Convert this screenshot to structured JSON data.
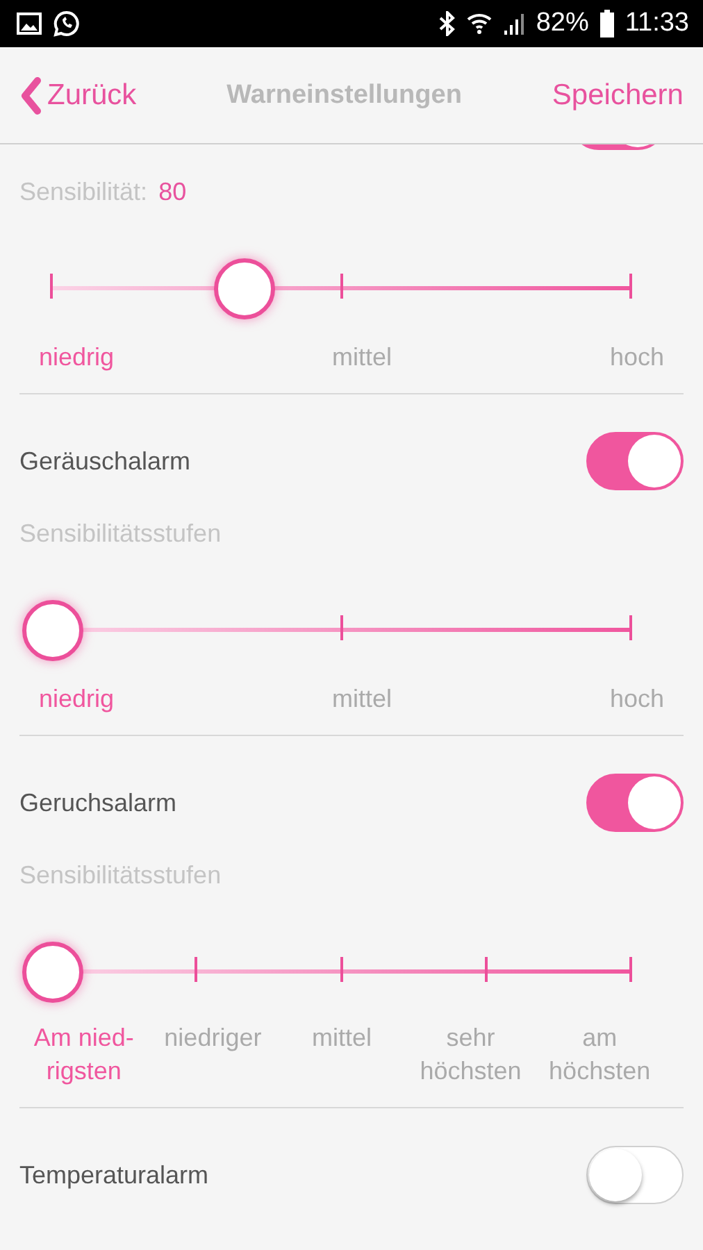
{
  "status_bar": {
    "battery": "82%",
    "time": "11:33"
  },
  "nav": {
    "back": "Zurück",
    "title": "Warneinstellungen",
    "save": "Speichern"
  },
  "top_toggle": {
    "on": true
  },
  "sections": [
    {
      "caption": "Sensibilität:",
      "value": "80",
      "slider": {
        "level": 0.33,
        "labels": [
          {
            "text": "niedrig",
            "selected": true
          },
          {
            "text": "mittel",
            "selected": false
          },
          {
            "text": "hoch",
            "selected": false
          }
        ]
      }
    },
    {
      "alarm": {
        "label": "Geräuschalarm",
        "on": true
      },
      "caption": "Sensibilitätsstufen",
      "slider": {
        "level": 0,
        "labels": [
          {
            "text": "niedrig",
            "selected": true
          },
          {
            "text": "mittel",
            "selected": false
          },
          {
            "text": "hoch",
            "selected": false
          }
        ]
      }
    },
    {
      "alarm": {
        "label": "Geruchsalarm",
        "on": true
      },
      "caption": "Sensibilitätsstufen",
      "slider": {
        "level": 0,
        "labels": [
          {
            "text": "Am nied-rigsten",
            "selected": true
          },
          {
            "text": "niedriger",
            "selected": false
          },
          {
            "text": "mittel",
            "selected": false
          },
          {
            "text": "sehr höchsten",
            "selected": false
          },
          {
            "text": "am höchsten",
            "selected": false
          }
        ]
      }
    },
    {
      "alarm": {
        "label": "Temperaturalarm",
        "on": false
      }
    }
  ]
}
